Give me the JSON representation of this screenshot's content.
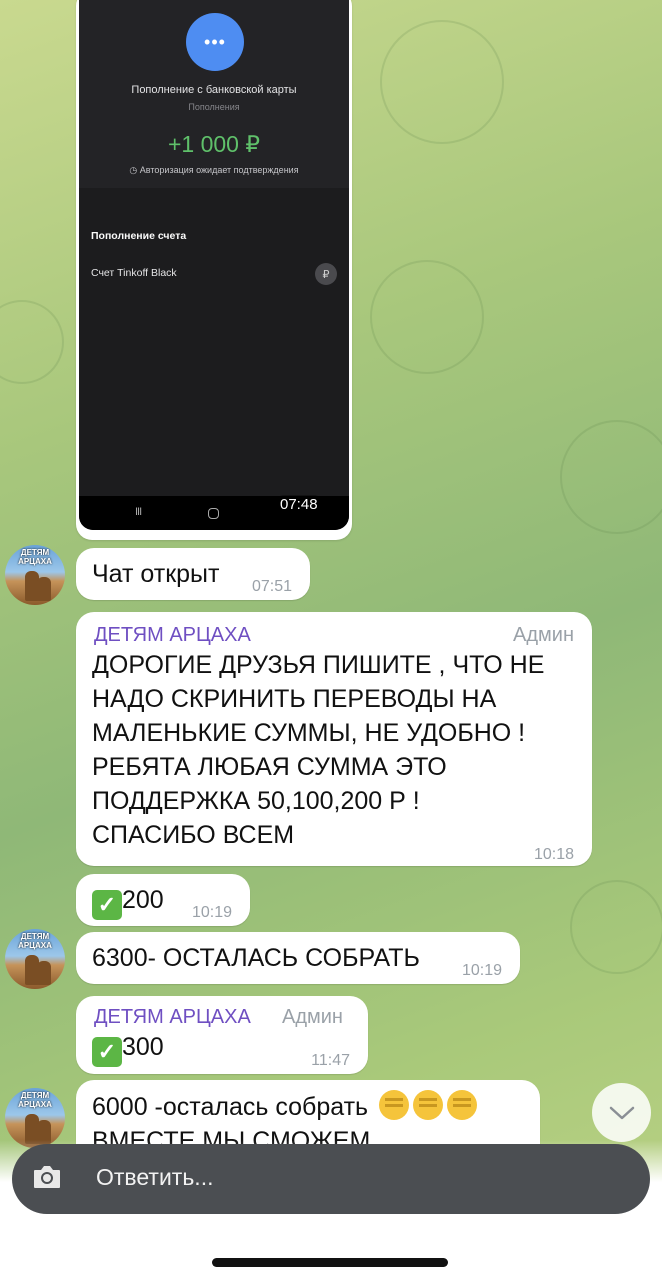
{
  "screenshot": {
    "title": "Пополнение с банковской карты",
    "subtitle": "Пополнения",
    "amount": "+1 000 ₽",
    "status": "Авторизация ожидает подтверждения",
    "section": "Пополнение счета",
    "account": "Счет Tinkoff Black",
    "icon_glyph": "•••",
    "ruble_glyph": "₽",
    "nav_recent": "III",
    "time": "07:48"
  },
  "avatar_text": "ДЕТЯМ АРЦАХА",
  "messages": [
    {
      "text": "Чат открыт",
      "time": "07:51"
    },
    {
      "sender": "ДЕТЯМ АРЦАХА",
      "role": "Админ",
      "lines": [
        "ДОРОГИЕ ДРУЗЬЯ ПИШИТЕ , ЧТО НЕ",
        "НАДО СКРИНИТЬ ПЕРЕВОДЫ НА",
        "МАЛЕНЬКИЕ СУММЫ, НЕ УДОБНО !",
        "РЕБЯТА ЛЮБАЯ СУММА ЭТО",
        "ПОДДЕРЖКА 50,100,200 Р !",
        "СПАСИБО ВСЕМ"
      ],
      "time": "10:18"
    },
    {
      "check": "✓",
      "text": "200",
      "time": "10:19"
    },
    {
      "text": "6300- ОСТАЛАСЬ СОБРАТЬ",
      "time": "10:19"
    },
    {
      "sender": "ДЕТЯМ АРЦАХА",
      "role": "Админ",
      "check": "✓",
      "text": "300",
      "time": "11:47"
    },
    {
      "text": "6000 -осталась собрать",
      "line2": "ВМЕСТЕ МЫ СМОЖЕМ"
    }
  ],
  "reply_placeholder": "Ответить...",
  "icons": [
    "camera-icon",
    "chevron-down-icon",
    "fist-emoji-icon",
    "check-mark-icon"
  ],
  "colors": {
    "sender": "#6f4fc2",
    "amount": "#5fc06a",
    "check": "#5cb645"
  }
}
